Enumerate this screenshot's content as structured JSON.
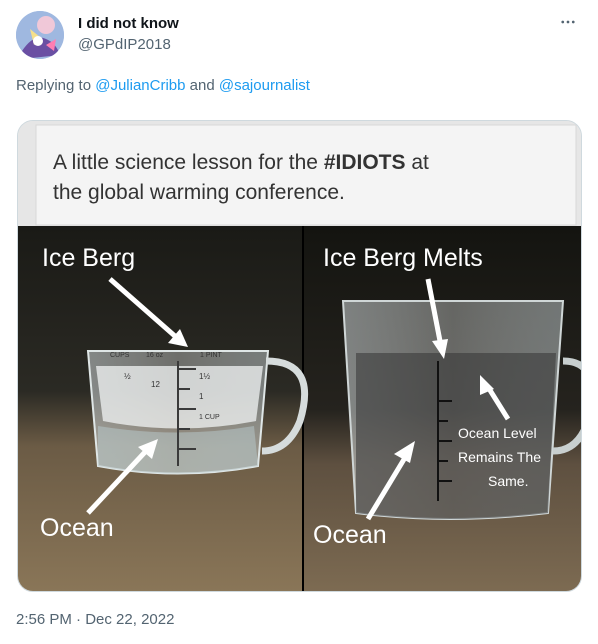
{
  "tweet": {
    "display_name": "I did not know",
    "handle": "@GPdIP2018",
    "reply_prefix": "Replying to ",
    "reply_user_1": "@JulianCribb",
    "reply_and": " and ",
    "reply_user_2": "@sajournalist",
    "time": "2:56 PM",
    "separator": " · ",
    "date": "Dec 22, 2022"
  },
  "meme": {
    "caption_line1_prefix": "A little science lesson for the ",
    "caption_line1_bold": "#IDIOTS",
    "caption_line1_suffix": " at",
    "caption_line2": "the global warming conference.",
    "left_label_top": "Ice Berg",
    "left_label_bottom": "Ocean",
    "right_label_top": "Ice Berg Melts",
    "right_label_bottom": "Ocean",
    "right_note_1": "Ocean Level",
    "right_note_2": "Remains The",
    "right_note_3": "Same.",
    "cup_mark_pint": "1 PINT",
    "cup_mark_oz": "16 oz",
    "cup_mark_cups": "CUPS",
    "cup_mark_12": "12",
    "cup_mark_1half": "1½",
    "cup_mark_1": "1",
    "cup_mark_half": "½",
    "cup_mark_1cup": "1 CUP"
  },
  "icons": {
    "more": "more-horizontal-icon",
    "avatar": "avatar-illustration"
  }
}
